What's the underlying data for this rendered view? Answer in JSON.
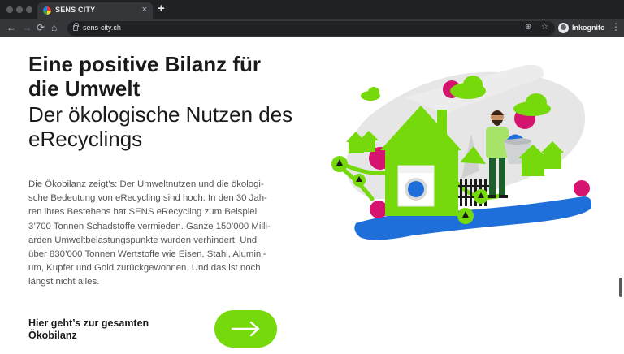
{
  "browser": {
    "tab_title": "SENS CITY",
    "tab_close": "×",
    "new_tab": "+",
    "back": "←",
    "forward": "→",
    "reload": "⟳",
    "home": "⌂",
    "url": "sens-city.ch",
    "zoom_icon": "⊕",
    "bookmark_icon": "☆",
    "profile_label": "Inkognito",
    "menu": "⋮"
  },
  "content": {
    "headline": "Eine positive Bilanz für die Umwelt",
    "subhead": "Der ökologische Nutzen des eRecyclings",
    "body": "Die Ökobilanz zeigt’s: Der Umweltnutzen und die ökologi-\nsche Bedeutung von eRecycling sind hoch. In den 30 Jah-\nren ihres Bestehens hat SENS eRecycling zum Beispiel\n3’700 Tonnen Schadstoffe vermieden. Ganze 150’000 Milli-\narden Umweltbelastungspunkte wurden verhindert. Und\nüber 830’000 Tonnen Wertstoffe wie Eisen, Stahl, Alumini-\num, Kupfer und Gold zurückgewonnen. Und das ist noch\nlängst nicht alles.",
    "cta_label": "Hier geht’s zur gesamten Ökobilanz"
  },
  "colors": {
    "brand_green": "#76d90b",
    "accent_magenta": "#d6136e",
    "accent_blue": "#1e6fd9",
    "grey_shape": "#e6e6e6"
  },
  "icons": {
    "cta": "arrow-right-icon",
    "illustration": "recycling-scene"
  }
}
